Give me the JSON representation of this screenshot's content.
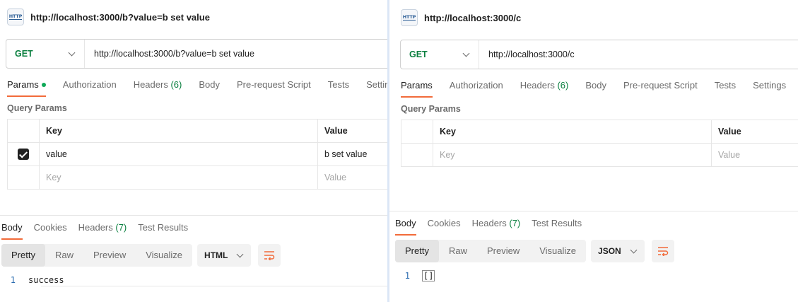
{
  "left": {
    "title": "http://localhost:3000/b?value=b set value",
    "http_icon_label": "HTTP",
    "method": "GET",
    "url": "http://localhost:3000/b?value=b set value",
    "request_tabs": [
      "Params",
      "Authorization",
      "Headers",
      "Body",
      "Pre-request Script",
      "Tests",
      "Settin"
    ],
    "headers_count": "(6)",
    "query_params_label": "Query Params",
    "table": {
      "key_header": "Key",
      "value_header": "Value",
      "row_key": "value",
      "row_value": "b set value",
      "key_placeholder": "Key",
      "value_placeholder": "Value"
    },
    "response_tabs": [
      "Body",
      "Cookies",
      "Headers",
      "Test Results"
    ],
    "response_headers_count": "(7)",
    "view_modes": [
      "Pretty",
      "Raw",
      "Preview",
      "Visualize"
    ],
    "format": "HTML",
    "line_number": "1",
    "code": "success"
  },
  "right": {
    "title": "http://localhost:3000/c",
    "http_icon_label": "HTTP",
    "method": "GET",
    "url": "http://localhost:3000/c",
    "request_tabs": [
      "Params",
      "Authorization",
      "Headers",
      "Body",
      "Pre-request Script",
      "Tests",
      "Settings"
    ],
    "headers_count": "(6)",
    "query_params_label": "Query Params",
    "table": {
      "key_header": "Key",
      "value_header": "Value",
      "key_placeholder": "Key",
      "value_placeholder": "Value"
    },
    "response_tabs": [
      "Body",
      "Cookies",
      "Headers",
      "Test Results"
    ],
    "response_headers_count": "(7)",
    "view_modes": [
      "Pretty",
      "Raw",
      "Preview",
      "Visualize"
    ],
    "format": "JSON",
    "line_number": "1",
    "code": "[]"
  },
  "colors": {
    "accent": "#f26b3a",
    "method_get": "#0a7f3f",
    "param_active_dot": "#0fa958"
  },
  "icons": [
    "http-icon",
    "chevron-down-icon",
    "checkbox-checked-icon",
    "wrap-lines-icon"
  ]
}
